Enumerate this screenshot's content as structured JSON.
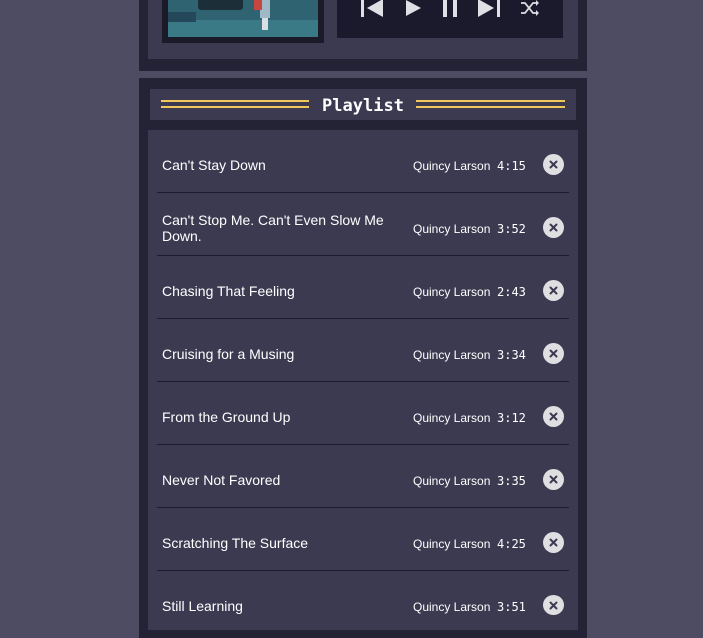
{
  "player": {
    "controls": [
      {
        "name": "previous-button",
        "icon": "skip-previous-icon"
      },
      {
        "name": "play-button",
        "icon": "play-icon"
      },
      {
        "name": "pause-button",
        "icon": "pause-icon"
      },
      {
        "name": "next-button",
        "icon": "skip-next-icon"
      },
      {
        "name": "shuffle-button",
        "icon": "shuffle-icon"
      }
    ]
  },
  "playlist": {
    "title": "Playlist",
    "songs": [
      {
        "title": "Can't Stay Down",
        "artist": "Quincy Larson",
        "duration": "4:15"
      },
      {
        "title": "Can't Stop Me. Can't Even Slow Me Down.",
        "artist": "Quincy Larson",
        "duration": "3:52"
      },
      {
        "title": "Chasing That Feeling",
        "artist": "Quincy Larson",
        "duration": "2:43"
      },
      {
        "title": "Cruising for a Musing",
        "artist": "Quincy Larson",
        "duration": "3:34"
      },
      {
        "title": "From the Ground Up",
        "artist": "Quincy Larson",
        "duration": "3:12"
      },
      {
        "title": "Never Not Favored",
        "artist": "Quincy Larson",
        "duration": "3:35"
      },
      {
        "title": "Scratching The Surface",
        "artist": "Quincy Larson",
        "duration": "4:25"
      },
      {
        "title": "Still Learning",
        "artist": "Quincy Larson",
        "duration": "3:51"
      }
    ]
  },
  "colors": {
    "background": "#4d4c63",
    "panel_dark": "#242335",
    "panel_mid": "#3b3a51",
    "accent": "#f1c65b",
    "text": "#ffffff"
  }
}
